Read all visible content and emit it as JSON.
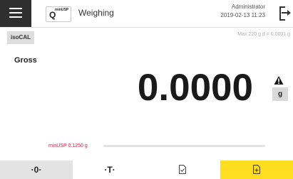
{
  "header": {
    "menu_icon": "hamburger-menu-icon",
    "method_icon": {
      "letter": "Q",
      "tag": "minUSP"
    },
    "title": "Weighing",
    "user": "Administrator",
    "datetime": "2019-02-13  11:23",
    "logout_icon": "logout-icon"
  },
  "info": {
    "isocal_label": "isoCAL",
    "capacity": "Max 220 g  d = 0.0001 g"
  },
  "display": {
    "mode": "Gross",
    "weight": "0.0000",
    "unit": "g",
    "warning_icon": "warning-triangle-icon"
  },
  "min_usp": {
    "label": "minUSP 0.1250 g",
    "progress": 0
  },
  "buttons": {
    "zero": "·0·",
    "tare": "·T·",
    "document_icon": "document-check-icon",
    "add_icon": "add-document-icon"
  },
  "colors": {
    "accent": "#ffdd1f",
    "alert": "#d01f3c",
    "menu_bg": "#2f2f2f"
  }
}
